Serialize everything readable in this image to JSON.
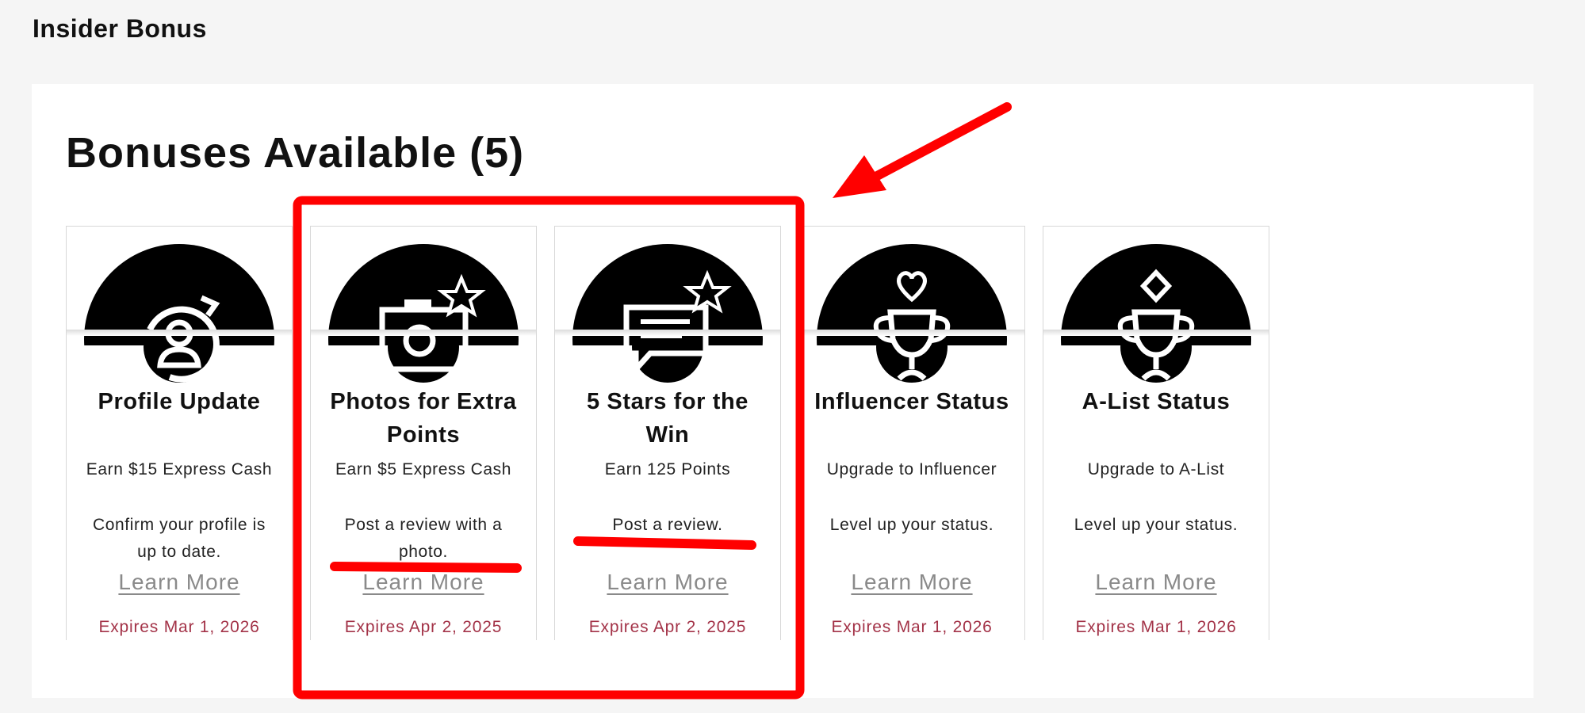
{
  "page": {
    "title": "Insider Bonus"
  },
  "section": {
    "title": "Bonuses Available (5)"
  },
  "cards": [
    {
      "title": "Profile Update",
      "reward": "Earn $15 Express Cash",
      "description": "Confirm your profile is up to date.",
      "link": "Learn More",
      "expiry": "Expires Mar 1, 2026",
      "icon": "profile-refresh-icon"
    },
    {
      "title": "Photos for Extra Points",
      "reward": "Earn $5 Express Cash",
      "description": "Post a review with a photo.",
      "link": "Learn More",
      "expiry": "Expires Apr 2, 2025",
      "icon": "camera-star-icon"
    },
    {
      "title": "5 Stars for the Win",
      "reward": "Earn 125 Points",
      "description": "Post a review.",
      "link": "Learn More",
      "expiry": "Expires Apr 2, 2025",
      "icon": "review-star-icon"
    },
    {
      "title": "Influencer Status",
      "reward": "Upgrade to Influencer",
      "description": "Level up your status.",
      "link": "Learn More",
      "expiry": "Expires Mar 1, 2026",
      "icon": "trophy-heart-icon"
    },
    {
      "title": "A-List Status",
      "reward": "Upgrade to A-List",
      "description": "Level up your status.",
      "link": "Learn More",
      "expiry": "Expires Mar 1, 2026",
      "icon": "trophy-diamond-icon"
    }
  ],
  "colors": {
    "expiry": "#a33348",
    "annotation": "#ff0000",
    "link": "#8a8a8a"
  }
}
